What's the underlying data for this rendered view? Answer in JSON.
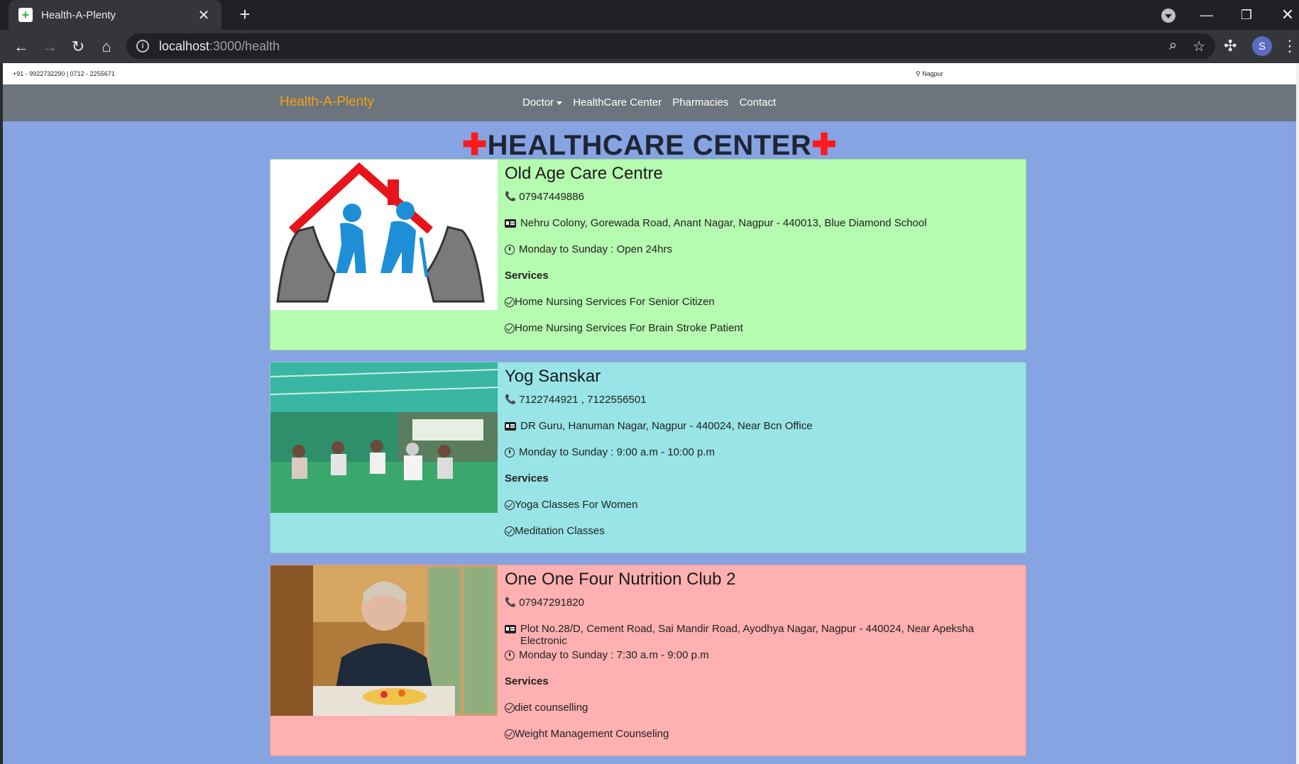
{
  "browser": {
    "tab_title": "Health-A-Plenty",
    "favicon_glyph": "+",
    "url_host": "localhost",
    "url_path": ":3000/health",
    "profile_initial": "S"
  },
  "topbar": {
    "phone": "+91 - 9922732290 | 0712 - 2255671",
    "location": "Nagpur"
  },
  "navbar": {
    "brand": "Health-A-Plenty",
    "links": [
      "Doctor",
      "HealthCare Center",
      "Pharmacies",
      "Contact"
    ]
  },
  "page": {
    "heading": "HEALTHCARE CENTER",
    "cross_glyph": "✚"
  },
  "cards": [
    {
      "name": "Old Age Care Centre",
      "phone": " 07947449886",
      "address": "Nehru Colony, Gorewada Road, Anant Nagar, Nagpur - 440013, Blue Diamond School",
      "hours": "Monday to Sunday : Open 24hrs",
      "services_label": "Services",
      "services": [
        "Home Nursing Services For Senior Citizen",
        "Home Nursing Services For Brain Stroke Patient"
      ],
      "bg": "#b5fbb0"
    },
    {
      "name": "Yog Sanskar",
      "phone": " 7122744921 , 7122556501",
      "address": "DR Guru, Hanuman Nagar, Nagpur - 440024, Near Bcn Office",
      "hours": "Monday to Sunday : 9:00 a.m - 10:00 p.m",
      "services_label": "Services",
      "services": [
        "Yoga Classes For Women",
        "Meditation Classes"
      ],
      "bg": "#98e4e6"
    },
    {
      "name": "One One Four Nutrition Club 2",
      "phone": "07947291820",
      "address": "Plot No.28/D, Cement Road, Sai Mandir Road, Ayodhya Nagar, Nagpur - 440024, Near Apeksha Electronic",
      "hours": "Monday to Sunday : 7:30 a.m - 9:00 p.m",
      "services_label": "Services",
      "services": [
        "diet counselling",
        "Weight Management Counseling"
      ],
      "bg": "#ffb0b0"
    }
  ],
  "colors": {
    "page_bg": "#86a3e2",
    "navbar_bg": "#6c757d",
    "brand": "#f4a20e",
    "cross": "#ff1a1a"
  }
}
